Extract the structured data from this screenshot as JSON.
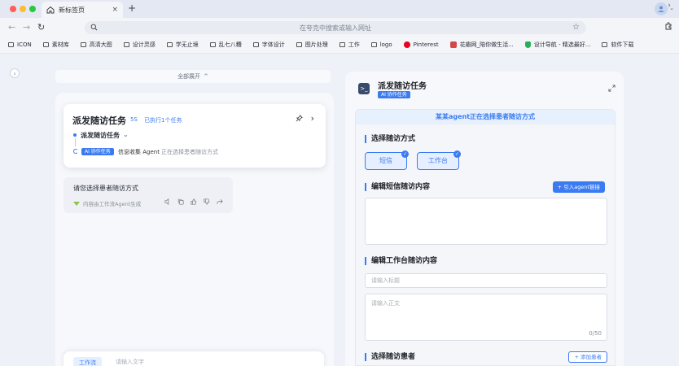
{
  "browser": {
    "tab_title": "新标签页",
    "tab_close": "×",
    "new_tab": "+",
    "address_placeholder": "在夸克中搜索或输入网址",
    "bookmarks": [
      {
        "label": "ICON",
        "icon": "folder-icon"
      },
      {
        "label": "素材库",
        "icon": "folder-icon"
      },
      {
        "label": "高清大图",
        "icon": "folder-icon"
      },
      {
        "label": "设计灵感",
        "icon": "folder-icon"
      },
      {
        "label": "学无止境",
        "icon": "folder-icon"
      },
      {
        "label": "乱七八糟",
        "icon": "folder-icon"
      },
      {
        "label": "字体设计",
        "icon": "folder-icon"
      },
      {
        "label": "图片处理",
        "icon": "folder-icon"
      },
      {
        "label": "工作",
        "icon": "folder-icon"
      },
      {
        "label": "logo",
        "icon": "folder-icon"
      },
      {
        "label": "Pinterest",
        "icon": "pinterest-icon"
      },
      {
        "label": "花瓣网_陪你做生活...",
        "icon": "huaban-icon"
      },
      {
        "label": "设计导航 - 精选最好...",
        "icon": "shield-icon"
      },
      {
        "label": "软件下载",
        "icon": "folder-icon"
      }
    ]
  },
  "left": {
    "expand_label": "全部展开",
    "task": {
      "title": "派发随访任务",
      "time": "5S",
      "executed": "已执行1个任务",
      "sub_title": "派发随访任务",
      "ai_tag": "AI 协作任务",
      "agent_name": "信息收集 Agent",
      "agent_status": "正在选择患者随访方式"
    },
    "message": {
      "text": "请您选择患者随访方式",
      "footer": "内容由工作流Agent生成"
    },
    "input": {
      "tag": "工作流",
      "placeholder": "请输入文字"
    }
  },
  "right": {
    "title": "派发随访任务",
    "ai_tag": "AI 协作任务",
    "banner": "某某agent正在选择患者随访方式",
    "section_method": "选择随访方式",
    "options": [
      {
        "label": "短信",
        "checked": true
      },
      {
        "label": "工作台",
        "checked": true
      }
    ],
    "section_sms": "编辑短信随访内容",
    "import_button": "+ 引入agent链接",
    "section_workbench": "编辑工作台随访内容",
    "title_placeholder": "请输入标题",
    "body_placeholder": "请输入正文",
    "counter": "0/50",
    "section_patients": "选择随访患者",
    "add_patient_button": "+ 添加患者"
  },
  "colors": {
    "accent": "#3a7bf2",
    "banner_bg": "#e7f0fd"
  }
}
